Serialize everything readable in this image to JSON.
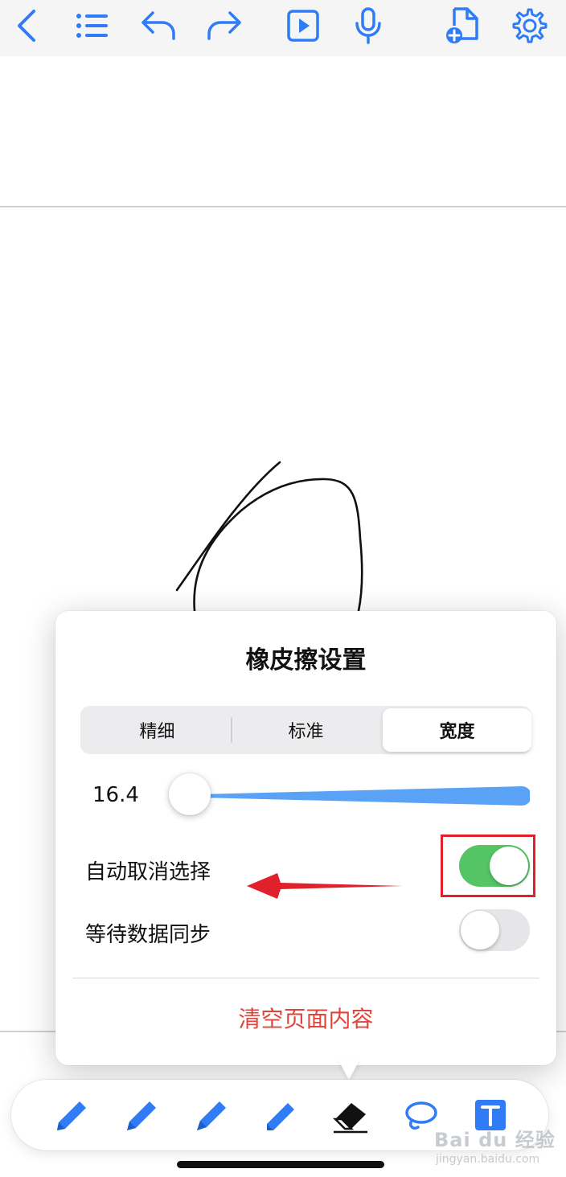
{
  "toolbar_top": {
    "icons": [
      "back-chevron-icon",
      "list-icon",
      "undo-icon",
      "redo-icon",
      "play-icon",
      "microphone-icon",
      "add-page-icon",
      "gear-icon"
    ]
  },
  "eraser_popover": {
    "title": "橡皮擦设置",
    "segments": [
      "精细",
      "标准",
      "宽度"
    ],
    "active_segment": "宽度",
    "slider_value": "16.4",
    "slider_level": 0.0,
    "auto_deselect": {
      "label": "自动取消选择",
      "on": true
    },
    "wait_sync": {
      "label": "等待数据同步",
      "on": false
    },
    "clear_action": "清空页面内容"
  },
  "bottom_tools": [
    "pen-tool-1",
    "pen-tool-2",
    "pen-tool-3",
    "highlighter-tool",
    "eraser-tool",
    "lasso-tool",
    "text-tool"
  ],
  "watermark": {
    "main": "Bai du 经验",
    "sub": "jingyan.baidu.com"
  },
  "colors": {
    "accent": "#2f7cf6",
    "toggle_on": "#55c464",
    "destructive": "#e0443a",
    "annotation": "#e0202a"
  }
}
